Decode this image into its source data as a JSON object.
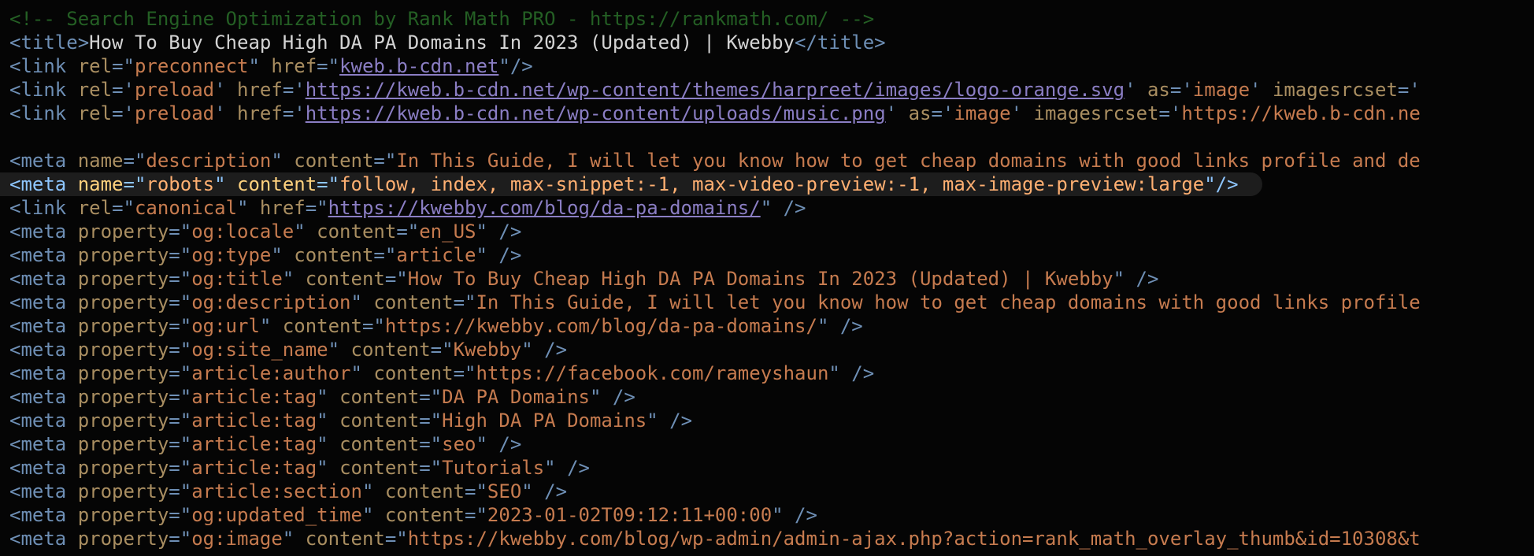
{
  "colors": {
    "background": "#050505",
    "comment": "#245f24",
    "tag": "#6e8fb5",
    "attribute": "#a98e61",
    "string": "#c67b4f",
    "text": "#d4d4d4",
    "link": "#8b7ec4",
    "highlight_row": "#1d1d1d"
  },
  "lines": [
    [
      {
        "c": "comment",
        "t": "<!-- Search Engine Optimization by Rank Math PRO - https://rankmath.com/ -->"
      }
    ],
    [
      {
        "c": "tag",
        "t": "<title>"
      },
      {
        "c": "text",
        "t": "How To Buy Cheap High DA PA Domains In 2023 (Updated) | Kwebby"
      },
      {
        "c": "tag",
        "t": "</title>"
      }
    ],
    [
      {
        "c": "tag",
        "t": "<link "
      },
      {
        "c": "attr",
        "t": "rel"
      },
      {
        "c": "tag",
        "t": "=\""
      },
      {
        "c": "str",
        "t": "preconnect"
      },
      {
        "c": "tag",
        "t": "\" "
      },
      {
        "c": "attr",
        "t": "href"
      },
      {
        "c": "tag",
        "t": "=\""
      },
      {
        "c": "link",
        "t": "kweb.b-cdn.net"
      },
      {
        "c": "tag",
        "t": "\"/>"
      }
    ],
    [
      {
        "c": "tag",
        "t": "<link "
      },
      {
        "c": "attr",
        "t": "rel"
      },
      {
        "c": "tag",
        "t": "='"
      },
      {
        "c": "str",
        "t": "preload"
      },
      {
        "c": "tag",
        "t": "' "
      },
      {
        "c": "attr",
        "t": "href"
      },
      {
        "c": "tag",
        "t": "='"
      },
      {
        "c": "link",
        "t": "https://kweb.b-cdn.net/wp-content/themes/harpreet/images/logo-orange.svg"
      },
      {
        "c": "tag",
        "t": "' "
      },
      {
        "c": "attr",
        "t": "as"
      },
      {
        "c": "tag",
        "t": "='"
      },
      {
        "c": "str",
        "t": "image"
      },
      {
        "c": "tag",
        "t": "' "
      },
      {
        "c": "attr",
        "t": "imagesrcset"
      },
      {
        "c": "tag",
        "t": "='"
      }
    ],
    [
      {
        "c": "tag",
        "t": "<link "
      },
      {
        "c": "attr",
        "t": "rel"
      },
      {
        "c": "tag",
        "t": "='"
      },
      {
        "c": "str",
        "t": "preload"
      },
      {
        "c": "tag",
        "t": "' "
      },
      {
        "c": "attr",
        "t": "href"
      },
      {
        "c": "tag",
        "t": "='"
      },
      {
        "c": "link",
        "t": "https://kweb.b-cdn.net/wp-content/uploads/music.png"
      },
      {
        "c": "tag",
        "t": "' "
      },
      {
        "c": "attr",
        "t": "as"
      },
      {
        "c": "tag",
        "t": "='"
      },
      {
        "c": "str",
        "t": "image"
      },
      {
        "c": "tag",
        "t": "' "
      },
      {
        "c": "attr",
        "t": "imagesrcset"
      },
      {
        "c": "tag",
        "t": "='"
      },
      {
        "c": "str",
        "t": "https://kweb.b-cdn.ne"
      }
    ],
    [],
    [
      {
        "c": "tag",
        "t": "<meta "
      },
      {
        "c": "attr",
        "t": "name"
      },
      {
        "c": "tag",
        "t": "=\""
      },
      {
        "c": "str",
        "t": "description"
      },
      {
        "c": "tag",
        "t": "\" "
      },
      {
        "c": "attr",
        "t": "content"
      },
      {
        "c": "tag",
        "t": "=\""
      },
      {
        "c": "str",
        "t": "In This Guide, I will let you know how to get cheap domains with good links profile and de"
      }
    ],
    [
      {
        "c": "tag",
        "t": "<meta "
      },
      {
        "c": "attr",
        "t": "name"
      },
      {
        "c": "tag",
        "t": "=\""
      },
      {
        "c": "str",
        "t": "robots"
      },
      {
        "c": "tag",
        "t": "\" "
      },
      {
        "c": "attr",
        "t": "content"
      },
      {
        "c": "tag",
        "t": "=\""
      },
      {
        "c": "str",
        "t": "follow, index, max-snippet:-1, max-video-preview:-1, max-image-preview:large"
      },
      {
        "c": "tag",
        "t": "\"/>"
      }
    ],
    [
      {
        "c": "tag",
        "t": "<link "
      },
      {
        "c": "attr",
        "t": "rel"
      },
      {
        "c": "tag",
        "t": "=\""
      },
      {
        "c": "str",
        "t": "canonical"
      },
      {
        "c": "tag",
        "t": "\" "
      },
      {
        "c": "attr",
        "t": "href"
      },
      {
        "c": "tag",
        "t": "=\""
      },
      {
        "c": "link",
        "t": "https://kwebby.com/blog/da-pa-domains/"
      },
      {
        "c": "tag",
        "t": "\" />"
      }
    ],
    [
      {
        "c": "tag",
        "t": "<meta "
      },
      {
        "c": "attr",
        "t": "property"
      },
      {
        "c": "tag",
        "t": "=\""
      },
      {
        "c": "str",
        "t": "og:locale"
      },
      {
        "c": "tag",
        "t": "\" "
      },
      {
        "c": "attr",
        "t": "content"
      },
      {
        "c": "tag",
        "t": "=\""
      },
      {
        "c": "str",
        "t": "en_US"
      },
      {
        "c": "tag",
        "t": "\" />"
      }
    ],
    [
      {
        "c": "tag",
        "t": "<meta "
      },
      {
        "c": "attr",
        "t": "property"
      },
      {
        "c": "tag",
        "t": "=\""
      },
      {
        "c": "str",
        "t": "og:type"
      },
      {
        "c": "tag",
        "t": "\" "
      },
      {
        "c": "attr",
        "t": "content"
      },
      {
        "c": "tag",
        "t": "=\""
      },
      {
        "c": "str",
        "t": "article"
      },
      {
        "c": "tag",
        "t": "\" />"
      }
    ],
    [
      {
        "c": "tag",
        "t": "<meta "
      },
      {
        "c": "attr",
        "t": "property"
      },
      {
        "c": "tag",
        "t": "=\""
      },
      {
        "c": "str",
        "t": "og:title"
      },
      {
        "c": "tag",
        "t": "\" "
      },
      {
        "c": "attr",
        "t": "content"
      },
      {
        "c": "tag",
        "t": "=\""
      },
      {
        "c": "str",
        "t": "How To Buy Cheap High DA PA Domains In 2023 (Updated) | Kwebby"
      },
      {
        "c": "tag",
        "t": "\" />"
      }
    ],
    [
      {
        "c": "tag",
        "t": "<meta "
      },
      {
        "c": "attr",
        "t": "property"
      },
      {
        "c": "tag",
        "t": "=\""
      },
      {
        "c": "str",
        "t": "og:description"
      },
      {
        "c": "tag",
        "t": "\" "
      },
      {
        "c": "attr",
        "t": "content"
      },
      {
        "c": "tag",
        "t": "=\""
      },
      {
        "c": "str",
        "t": "In This Guide, I will let you know how to get cheap domains with good links profile"
      }
    ],
    [
      {
        "c": "tag",
        "t": "<meta "
      },
      {
        "c": "attr",
        "t": "property"
      },
      {
        "c": "tag",
        "t": "=\""
      },
      {
        "c": "str",
        "t": "og:url"
      },
      {
        "c": "tag",
        "t": "\" "
      },
      {
        "c": "attr",
        "t": "content"
      },
      {
        "c": "tag",
        "t": "=\""
      },
      {
        "c": "str",
        "t": "https://kwebby.com/blog/da-pa-domains/"
      },
      {
        "c": "tag",
        "t": "\" />"
      }
    ],
    [
      {
        "c": "tag",
        "t": "<meta "
      },
      {
        "c": "attr",
        "t": "property"
      },
      {
        "c": "tag",
        "t": "=\""
      },
      {
        "c": "str",
        "t": "og:site_name"
      },
      {
        "c": "tag",
        "t": "\" "
      },
      {
        "c": "attr",
        "t": "content"
      },
      {
        "c": "tag",
        "t": "=\""
      },
      {
        "c": "str",
        "t": "Kwebby"
      },
      {
        "c": "tag",
        "t": "\" />"
      }
    ],
    [
      {
        "c": "tag",
        "t": "<meta "
      },
      {
        "c": "attr",
        "t": "property"
      },
      {
        "c": "tag",
        "t": "=\""
      },
      {
        "c": "str",
        "t": "article:author"
      },
      {
        "c": "tag",
        "t": "\" "
      },
      {
        "c": "attr",
        "t": "content"
      },
      {
        "c": "tag",
        "t": "=\""
      },
      {
        "c": "str",
        "t": "https://facebook.com/rameyshaun"
      },
      {
        "c": "tag",
        "t": "\" />"
      }
    ],
    [
      {
        "c": "tag",
        "t": "<meta "
      },
      {
        "c": "attr",
        "t": "property"
      },
      {
        "c": "tag",
        "t": "=\""
      },
      {
        "c": "str",
        "t": "article:tag"
      },
      {
        "c": "tag",
        "t": "\" "
      },
      {
        "c": "attr",
        "t": "content"
      },
      {
        "c": "tag",
        "t": "=\""
      },
      {
        "c": "str",
        "t": "DA PA Domains"
      },
      {
        "c": "tag",
        "t": "\" />"
      }
    ],
    [
      {
        "c": "tag",
        "t": "<meta "
      },
      {
        "c": "attr",
        "t": "property"
      },
      {
        "c": "tag",
        "t": "=\""
      },
      {
        "c": "str",
        "t": "article:tag"
      },
      {
        "c": "tag",
        "t": "\" "
      },
      {
        "c": "attr",
        "t": "content"
      },
      {
        "c": "tag",
        "t": "=\""
      },
      {
        "c": "str",
        "t": "High DA PA Domains"
      },
      {
        "c": "tag",
        "t": "\" />"
      }
    ],
    [
      {
        "c": "tag",
        "t": "<meta "
      },
      {
        "c": "attr",
        "t": "property"
      },
      {
        "c": "tag",
        "t": "=\""
      },
      {
        "c": "str",
        "t": "article:tag"
      },
      {
        "c": "tag",
        "t": "\" "
      },
      {
        "c": "attr",
        "t": "content"
      },
      {
        "c": "tag",
        "t": "=\""
      },
      {
        "c": "str",
        "t": "seo"
      },
      {
        "c": "tag",
        "t": "\" />"
      }
    ],
    [
      {
        "c": "tag",
        "t": "<meta "
      },
      {
        "c": "attr",
        "t": "property"
      },
      {
        "c": "tag",
        "t": "=\""
      },
      {
        "c": "str",
        "t": "article:tag"
      },
      {
        "c": "tag",
        "t": "\" "
      },
      {
        "c": "attr",
        "t": "content"
      },
      {
        "c": "tag",
        "t": "=\""
      },
      {
        "c": "str",
        "t": "Tutorials"
      },
      {
        "c": "tag",
        "t": "\" />"
      }
    ],
    [
      {
        "c": "tag",
        "t": "<meta "
      },
      {
        "c": "attr",
        "t": "property"
      },
      {
        "c": "tag",
        "t": "=\""
      },
      {
        "c": "str",
        "t": "article:section"
      },
      {
        "c": "tag",
        "t": "\" "
      },
      {
        "c": "attr",
        "t": "content"
      },
      {
        "c": "tag",
        "t": "=\""
      },
      {
        "c": "str",
        "t": "SEO"
      },
      {
        "c": "tag",
        "t": "\" />"
      }
    ],
    [
      {
        "c": "tag",
        "t": "<meta "
      },
      {
        "c": "attr",
        "t": "property"
      },
      {
        "c": "tag",
        "t": "=\""
      },
      {
        "c": "str",
        "t": "og:updated_time"
      },
      {
        "c": "tag",
        "t": "\" "
      },
      {
        "c": "attr",
        "t": "content"
      },
      {
        "c": "tag",
        "t": "=\""
      },
      {
        "c": "str",
        "t": "2023-01-02T09:12:11+00:00"
      },
      {
        "c": "tag",
        "t": "\" />"
      }
    ],
    [
      {
        "c": "tag",
        "t": "<meta "
      },
      {
        "c": "attr",
        "t": "property"
      },
      {
        "c": "tag",
        "t": "=\""
      },
      {
        "c": "str",
        "t": "og:image"
      },
      {
        "c": "tag",
        "t": "\" "
      },
      {
        "c": "attr",
        "t": "content"
      },
      {
        "c": "tag",
        "t": "=\""
      },
      {
        "c": "str",
        "t": "https://kwebby.com/blog/wp-admin/admin-ajax.php?action=rank_math_overlay_thumb&id=10308&t"
      }
    ]
  ]
}
